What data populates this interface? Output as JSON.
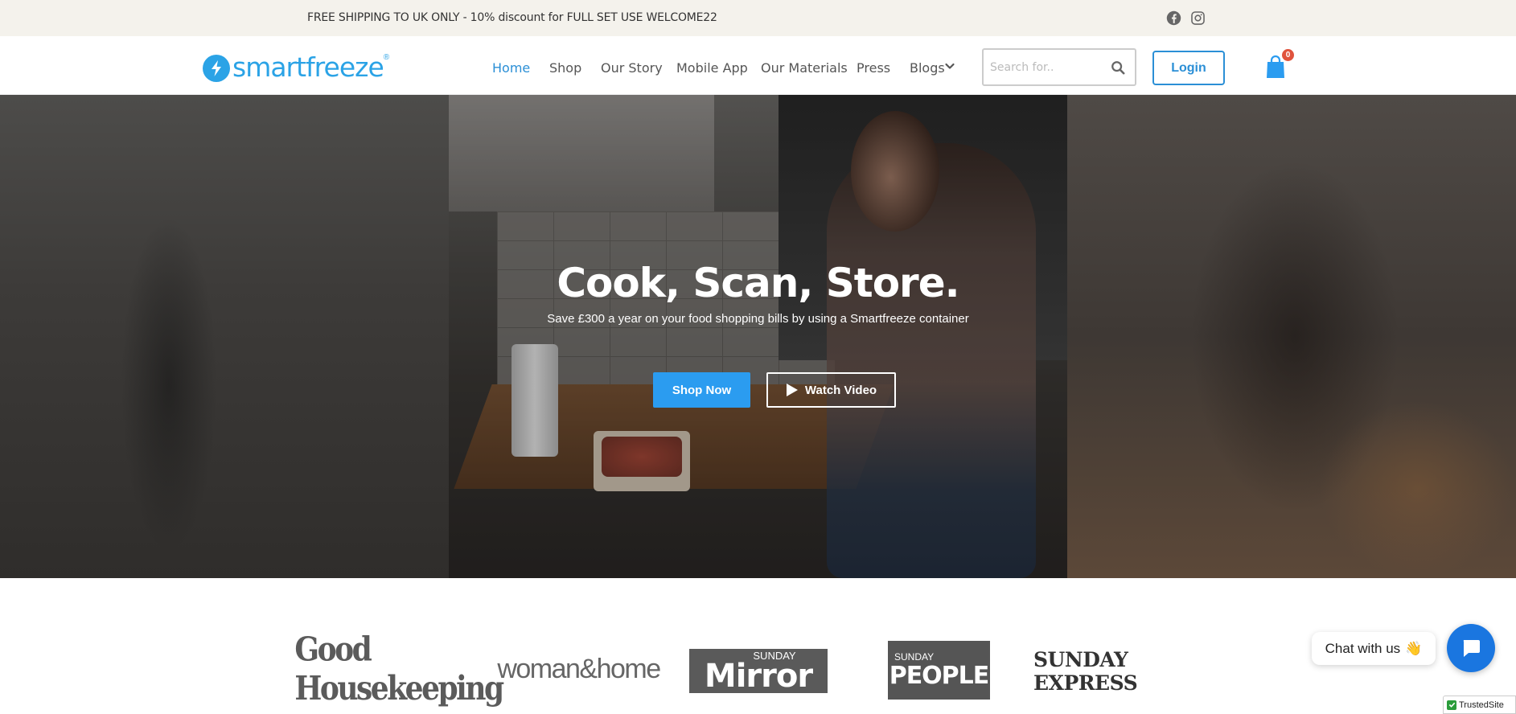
{
  "topbar": {
    "promo": "FREE SHIPPING TO UK ONLY - 10% discount for FULL SET USE WELCOME22",
    "social": [
      "facebook-icon",
      "instagram-icon"
    ]
  },
  "header": {
    "logo_text": "smartfreeze",
    "logo_reg": "®",
    "nav": [
      {
        "label": "Home",
        "active": true
      },
      {
        "label": "Shop"
      },
      {
        "label": "Our Story"
      },
      {
        "label": "Mobile App"
      },
      {
        "label": "Our Materials"
      },
      {
        "label": "Press"
      },
      {
        "label": "Blogs",
        "dropdown": true
      }
    ],
    "search_placeholder": "Search for..",
    "login_label": "Login",
    "cart_count": "0"
  },
  "hero": {
    "title": "Cook, Scan, Store.",
    "subtitle": "Save £300 a year on your food shopping bills by using a Smartfreeze container",
    "primary_cta": "Shop Now",
    "secondary_cta": "Watch Video"
  },
  "press": {
    "logos": [
      {
        "name": "Good Housekeeping"
      },
      {
        "name": "woman&home"
      },
      {
        "small": "SUNDAY",
        "big": "Mirror"
      },
      {
        "small": "SUNDAY",
        "big": "PEOPLE"
      },
      {
        "name": "SUNDAY EXPRESS"
      }
    ]
  },
  "chat": {
    "label": "Chat with us",
    "emoji": "👋"
  },
  "badge": {
    "label": "TrustedSite"
  },
  "colors": {
    "brand_blue": "#2ba3e6",
    "nav_active": "#2b8fd6",
    "cta_blue": "#2b9cf0",
    "cart_badge": "#e0533d",
    "chat_blue": "#1a76e0"
  }
}
